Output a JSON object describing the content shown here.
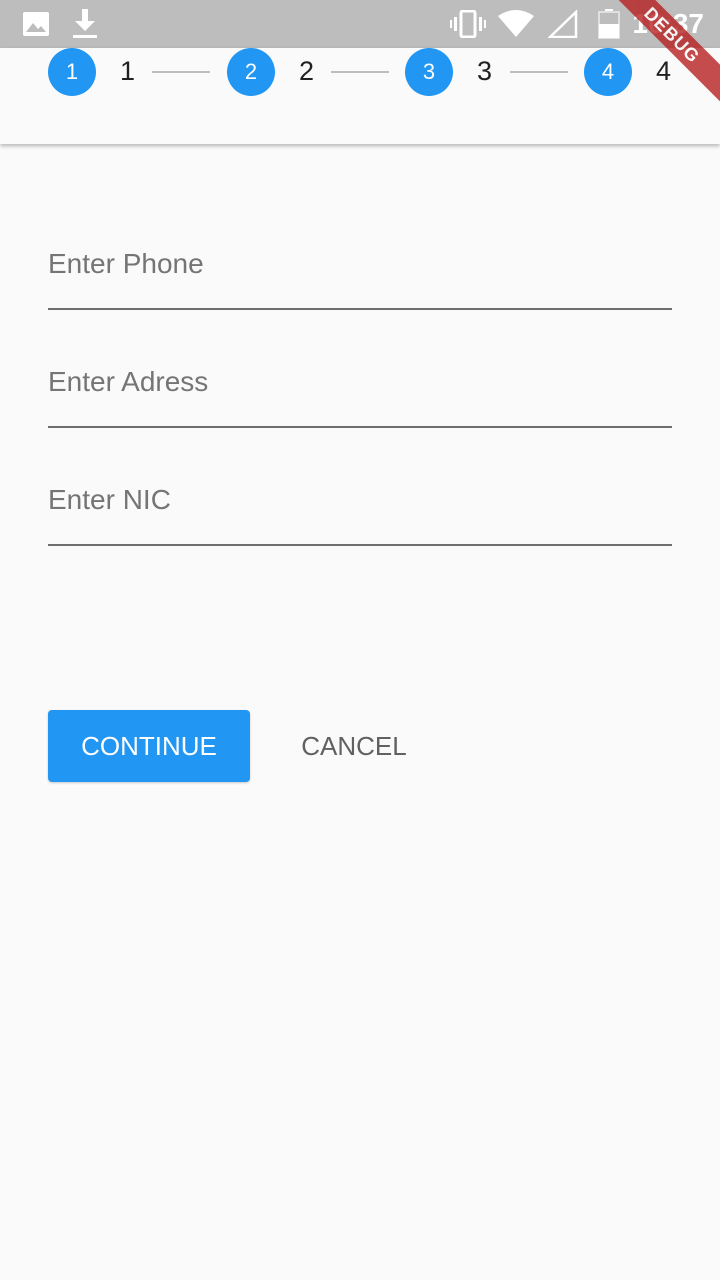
{
  "status_bar": {
    "time": "10:37",
    "left_icons": [
      "image-icon",
      "download-icon"
    ],
    "right_icons": [
      "vibrate-icon",
      "wifi-icon",
      "signal-icon",
      "battery-icon"
    ]
  },
  "debug_banner": "DEBUG",
  "stepper": {
    "steps": [
      {
        "number": "1",
        "label": "1"
      },
      {
        "number": "2",
        "label": "2"
      },
      {
        "number": "3",
        "label": "3"
      },
      {
        "number": "4",
        "label": "4"
      }
    ],
    "active_color": "#2196f3"
  },
  "form": {
    "phone": {
      "placeholder": "Enter Phone",
      "value": ""
    },
    "address": {
      "placeholder": "Enter Adress",
      "value": ""
    },
    "nic": {
      "placeholder": "Enter NIC",
      "value": ""
    }
  },
  "actions": {
    "continue_label": "CONTINUE",
    "cancel_label": "CANCEL"
  }
}
